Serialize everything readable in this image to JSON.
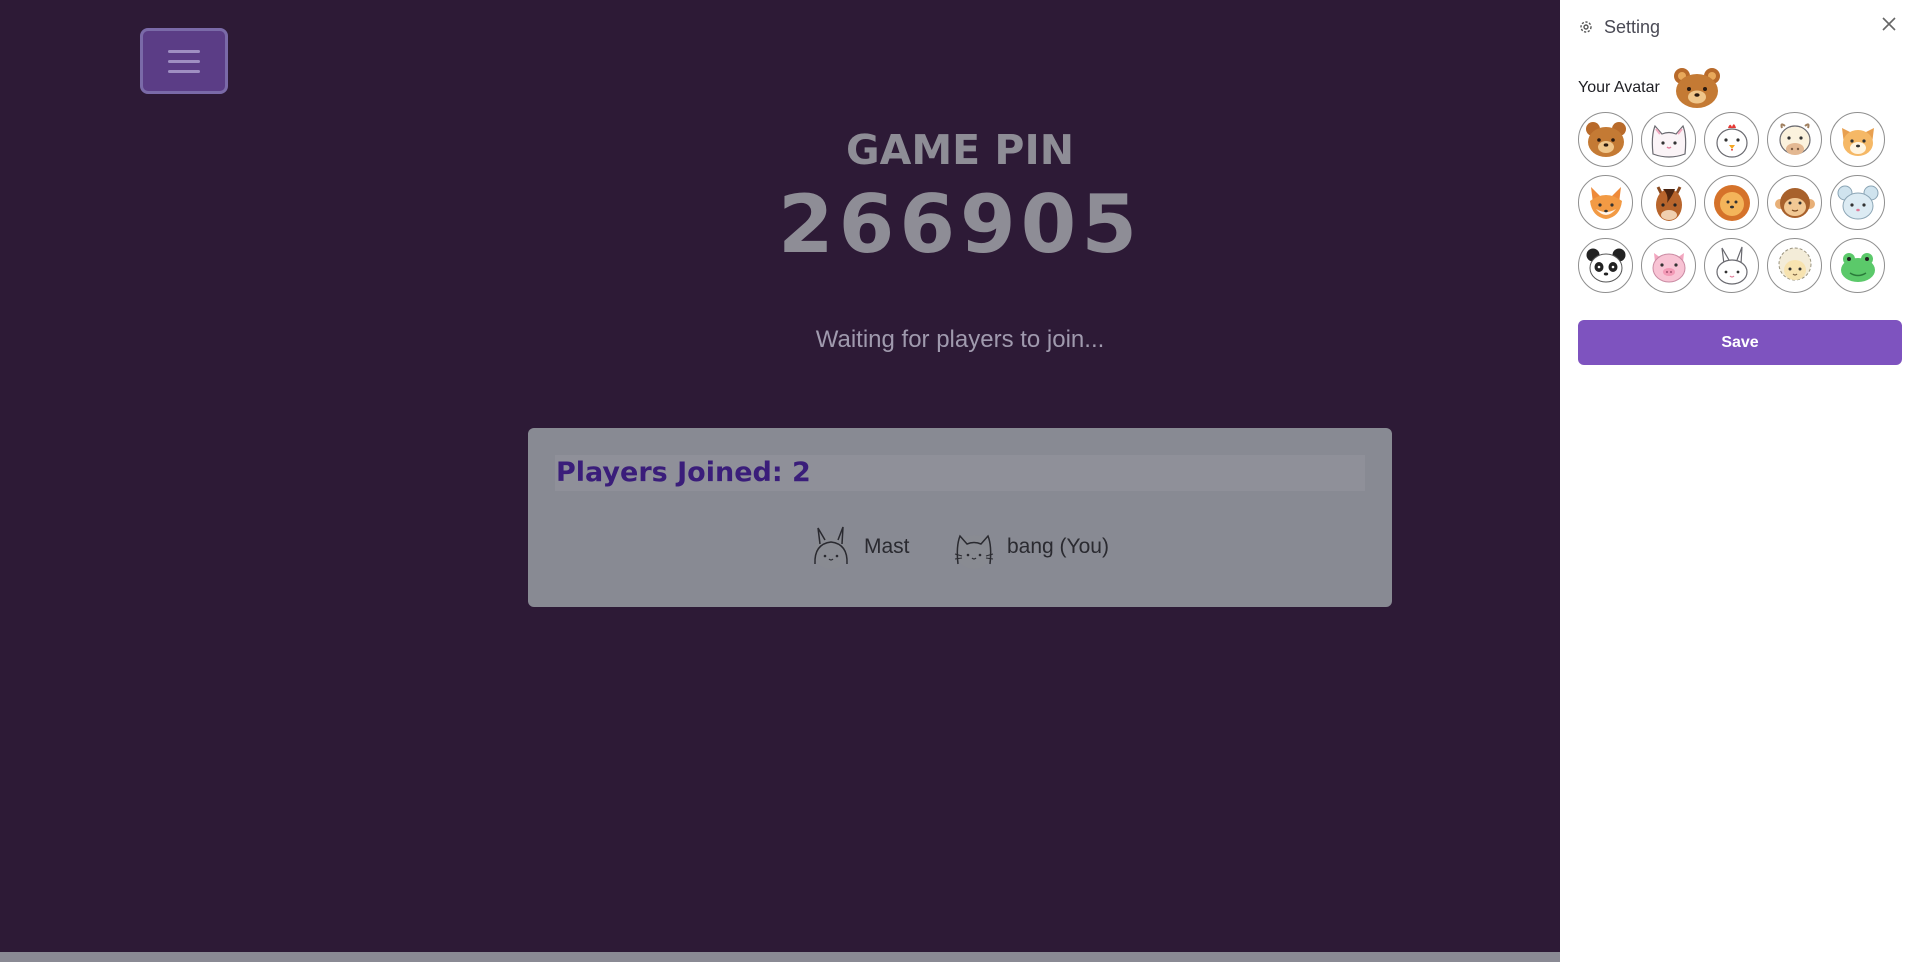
{
  "game": {
    "pin_label": "GAME PIN",
    "pin_value": "266905",
    "waiting_text": "Waiting for players to join..."
  },
  "players": {
    "title": "Players Joined: 2",
    "list": [
      {
        "name": "Mast",
        "avatar": "rabbit-icon"
      },
      {
        "name": "bang (You)",
        "avatar": "cat-icon"
      }
    ]
  },
  "settings": {
    "title": "Setting",
    "avatar_label": "Your Avatar",
    "current_avatar": "bear-icon",
    "avatars": [
      "bear-icon",
      "cat-icon",
      "chicken-icon",
      "cow-icon",
      "dog-icon",
      "fox-icon",
      "horse-icon",
      "lion-icon",
      "monkey-icon",
      "mouse-icon",
      "panda-icon",
      "pig-icon",
      "rabbit-icon",
      "sheep-icon",
      "frog-icon"
    ],
    "save_label": "Save"
  },
  "colors": {
    "background": "#2d1a36",
    "accent": "#7e53bf",
    "players_title": "#3a1d7a",
    "card": "#888a93"
  }
}
